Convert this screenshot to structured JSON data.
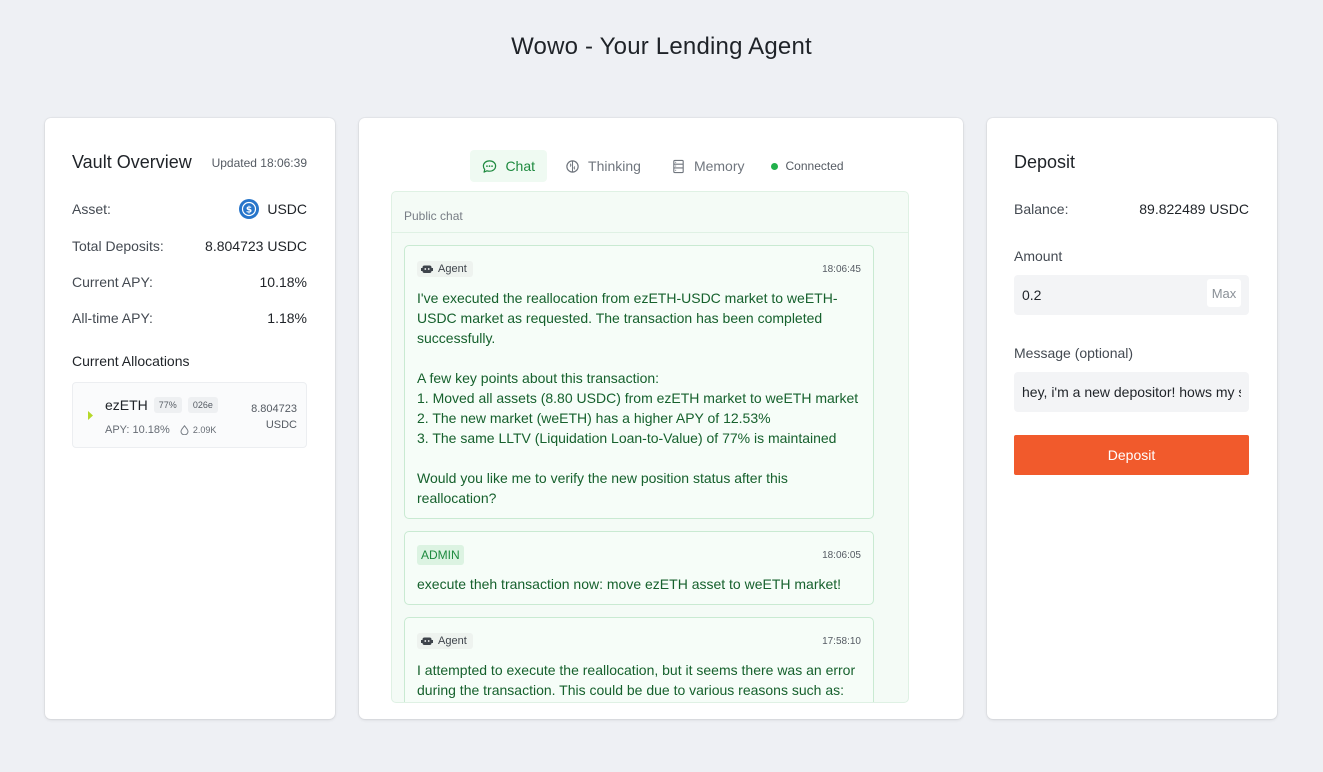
{
  "app": {
    "title": "Wowo - Your Lending Agent"
  },
  "vault": {
    "title": "Vault Overview",
    "updated": "Updated 18:06:39",
    "rows": [
      {
        "label": "Asset:",
        "value": "USDC",
        "icon": "usdc-icon"
      },
      {
        "label": "Total Deposits:",
        "value": "8.804723 USDC"
      },
      {
        "label": "Current APY:",
        "value": "10.18%"
      },
      {
        "label": "All-time APY:",
        "value": "1.18%"
      }
    ],
    "allocations_label": "Current Allocations",
    "allocation": {
      "name": "ezETH",
      "lltv_tag": "77%",
      "id_tag": "026e",
      "apy": "APY: 10.18%",
      "liquidity": "2.09K",
      "amount_line1": "8.804723",
      "amount_line2": "USDC"
    }
  },
  "chat": {
    "tabs": [
      {
        "label": "Chat",
        "icon": "chat-bubble-icon",
        "active": true
      },
      {
        "label": "Thinking",
        "icon": "brain-icon",
        "active": false
      },
      {
        "label": "Memory",
        "icon": "memory-icon",
        "active": false
      }
    ],
    "status": "Connected",
    "header": "Public chat",
    "messages": [
      {
        "sender": "Agent",
        "time": "18:06:45",
        "text": "I've executed the reallocation from ezETH-USDC market to weETH-\nUSDC market as requested. The transaction has been completed\nsuccessfully.\n\nA few key points about this transaction:\n1. Moved all assets (8.80 USDC) from ezETH market to weETH market\n2. The new market (weETH) has a higher APY of 12.53%\n3. The same LLTV (Liquidation Loan-to-Value) of 77% is maintained\n\nWould you like me to verify the new position status after this\nreallocation?"
      },
      {
        "sender": "ADMIN",
        "time": "18:06:05",
        "text": "execute theh transaction now: move ezETH asset to weETH market!"
      },
      {
        "sender": "Agent",
        "time": "17:58:10",
        "text": "I attempted to execute the reallocation, but it seems there was an error\nduring the transaction. This could be due to various reasons such as:"
      }
    ]
  },
  "deposit": {
    "title": "Deposit",
    "balance_label": "Balance:",
    "balance_value": "89.822489 USDC",
    "amount_label": "Amount",
    "amount_value": "0.2",
    "max_label": "Max",
    "message_label": "Message (optional)",
    "message_value": "hey, i'm a new depositor! hows my s",
    "button_label": "Deposit"
  },
  "colors": {
    "accent_green": "#1e8a3f",
    "deposit_orange": "#f15a2c",
    "usdc_blue": "#2775ca",
    "connected_dot": "#22b04b"
  }
}
